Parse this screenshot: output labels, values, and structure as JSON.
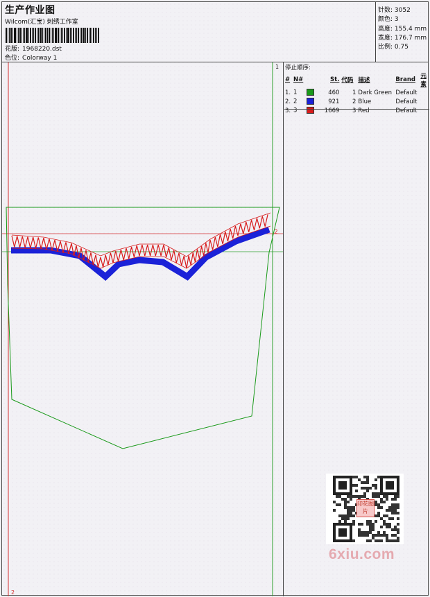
{
  "header": {
    "title": "生产作业图",
    "company": "Wilcom(汇宝) 刺绣工作室",
    "design_file_label": "花版:",
    "design_file": "1968220.dst",
    "colorway_label": "色位:",
    "colorway": "Colorway 1"
  },
  "stats": [
    {
      "label": "针数:",
      "value": "3052"
    },
    {
      "label": "颜色:",
      "value": "3"
    },
    {
      "label": "高度:",
      "value": "155.4 mm"
    },
    {
      "label": "宽度:",
      "value": "176.7 mm"
    },
    {
      "label": "比例:",
      "value": "0.75"
    }
  ],
  "stop_sequence": {
    "title": "停止顺序:",
    "headers": [
      "#",
      "N#",
      "St.",
      "代码",
      "描述",
      "Brand",
      "元素"
    ],
    "rows": [
      {
        "index": "1.",
        "needle": "1",
        "color": "#1a9a1a",
        "stitches": "460",
        "code": "1",
        "description": "Dark Green",
        "brand": "Default",
        "element": ""
      },
      {
        "index": "2.",
        "needle": "2",
        "color": "#1b22d8",
        "stitches": "921",
        "code": "2",
        "description": "Blue",
        "brand": "Default",
        "element": ""
      },
      {
        "index": "3.",
        "needle": "3",
        "color": "#d81b1b",
        "stitches": "1669",
        "code": "3",
        "description": "Red",
        "brand": "Default",
        "element": ""
      }
    ]
  },
  "design_markers": {
    "top_right": "1",
    "mid_right": "2",
    "bottom_left": "2"
  },
  "watermark": {
    "text": "6xiu.com",
    "stamp": "印花图片"
  }
}
